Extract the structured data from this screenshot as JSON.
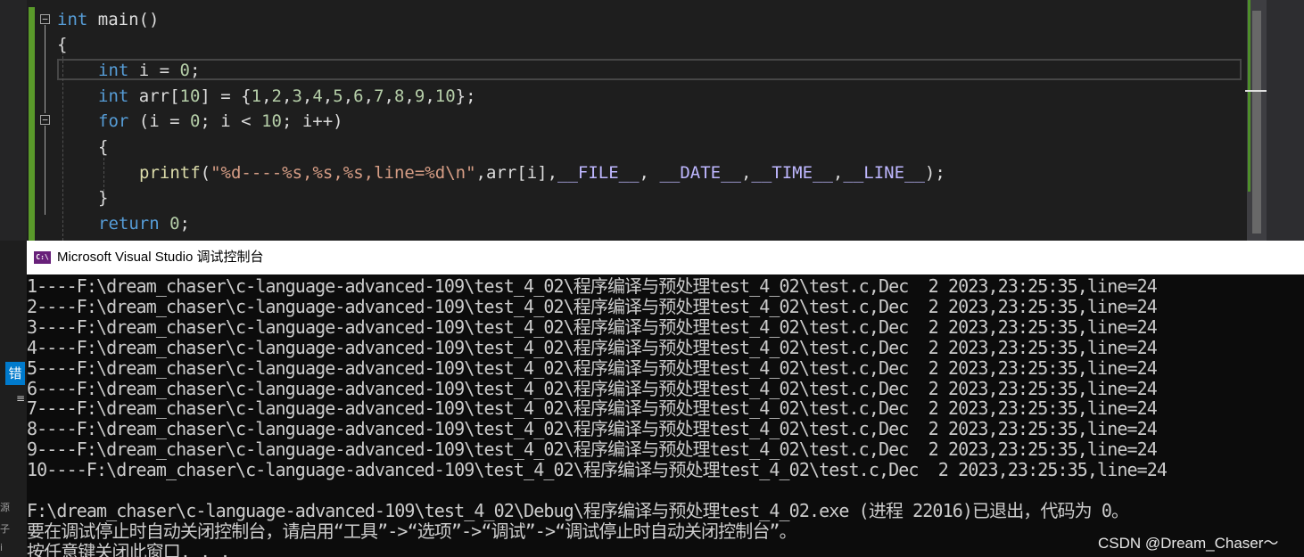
{
  "editor": {
    "lines": [
      {
        "indent": 0,
        "tokens": [
          [
            "kw",
            "int"
          ],
          [
            "txt",
            " main()"
          ]
        ]
      },
      {
        "indent": 0,
        "tokens": [
          [
            "txt",
            "{"
          ]
        ]
      },
      {
        "indent": 1,
        "tokens": [
          [
            "kw",
            "int"
          ],
          [
            "txt",
            " i = "
          ],
          [
            "num",
            "0"
          ],
          [
            "txt",
            ";"
          ]
        ]
      },
      {
        "indent": 1,
        "tokens": [
          [
            "kw",
            "int"
          ],
          [
            "txt",
            " arr["
          ],
          [
            "num",
            "10"
          ],
          [
            "txt",
            "] = {"
          ],
          [
            "num",
            "1"
          ],
          [
            "txt",
            ","
          ],
          [
            "num",
            "2"
          ],
          [
            "txt",
            ","
          ],
          [
            "num",
            "3"
          ],
          [
            "txt",
            ","
          ],
          [
            "num",
            "4"
          ],
          [
            "txt",
            ","
          ],
          [
            "num",
            "5"
          ],
          [
            "txt",
            ","
          ],
          [
            "num",
            "6"
          ],
          [
            "txt",
            ","
          ],
          [
            "num",
            "7"
          ],
          [
            "txt",
            ","
          ],
          [
            "num",
            "8"
          ],
          [
            "txt",
            ","
          ],
          [
            "num",
            "9"
          ],
          [
            "txt",
            ","
          ],
          [
            "num",
            "10"
          ],
          [
            "txt",
            "};"
          ]
        ]
      },
      {
        "indent": 1,
        "tokens": [
          [
            "kw",
            "for"
          ],
          [
            "txt",
            " (i = "
          ],
          [
            "num",
            "0"
          ],
          [
            "txt",
            "; i < "
          ],
          [
            "num",
            "10"
          ],
          [
            "txt",
            "; i++)"
          ]
        ]
      },
      {
        "indent": 1,
        "tokens": [
          [
            "txt",
            "{"
          ]
        ]
      },
      {
        "indent": 2,
        "tokens": [
          [
            "fn",
            "printf"
          ],
          [
            "txt",
            "("
          ],
          [
            "str",
            "\"%d----%s,%s,%s,line=%d\\n\""
          ],
          [
            "txt",
            ",arr[i],"
          ],
          [
            "mac",
            "__FILE__"
          ],
          [
            "txt",
            ", "
          ],
          [
            "mac",
            "__DATE__"
          ],
          [
            "txt",
            ","
          ],
          [
            "mac",
            "__TIME__"
          ],
          [
            "txt",
            ","
          ],
          [
            "mac",
            "__LINE__"
          ],
          [
            "txt",
            ");"
          ]
        ]
      },
      {
        "indent": 1,
        "tokens": [
          [
            "txt",
            "}"
          ]
        ]
      },
      {
        "indent": 1,
        "tokens": [
          [
            "kw",
            "return"
          ],
          [
            "txt",
            " "
          ],
          [
            "num",
            "0"
          ],
          [
            "txt",
            ";"
          ]
        ]
      }
    ]
  },
  "console": {
    "title": "Microsoft Visual Studio 调试控制台",
    "icon_text": "C:\\",
    "output_lines": [
      "1----F:\\dream_chaser\\c-language-advanced-109\\test_4_02\\程序编译与预处理test_4_02\\test.c,Dec  2 2023,23:25:35,line=24",
      "2----F:\\dream_chaser\\c-language-advanced-109\\test_4_02\\程序编译与预处理test_4_02\\test.c,Dec  2 2023,23:25:35,line=24",
      "3----F:\\dream_chaser\\c-language-advanced-109\\test_4_02\\程序编译与预处理test_4_02\\test.c,Dec  2 2023,23:25:35,line=24",
      "4----F:\\dream_chaser\\c-language-advanced-109\\test_4_02\\程序编译与预处理test_4_02\\test.c,Dec  2 2023,23:25:35,line=24",
      "5----F:\\dream_chaser\\c-language-advanced-109\\test_4_02\\程序编译与预处理test_4_02\\test.c,Dec  2 2023,23:25:35,line=24",
      "6----F:\\dream_chaser\\c-language-advanced-109\\test_4_02\\程序编译与预处理test_4_02\\test.c,Dec  2 2023,23:25:35,line=24",
      "7----F:\\dream_chaser\\c-language-advanced-109\\test_4_02\\程序编译与预处理test_4_02\\test.c,Dec  2 2023,23:25:35,line=24",
      "8----F:\\dream_chaser\\c-language-advanced-109\\test_4_02\\程序编译与预处理test_4_02\\test.c,Dec  2 2023,23:25:35,line=24",
      "9----F:\\dream_chaser\\c-language-advanced-109\\test_4_02\\程序编译与预处理test_4_02\\test.c,Dec  2 2023,23:25:35,line=24",
      "10----F:\\dream_chaser\\c-language-advanced-109\\test_4_02\\程序编译与预处理test_4_02\\test.c,Dec  2 2023,23:25:35,line=24",
      "",
      "F:\\dream_chaser\\c-language-advanced-109\\test_4_02\\Debug\\程序编译与预处理test_4_02.exe (进程 22016)已退出，代码为 0。",
      "要在调试停止时自动关闭控制台，请启用“工具”->“选项”->“调试”->“调试停止时自动关闭控制台”。",
      "按任意键关闭此窗口. . ."
    ]
  },
  "left_panel": {
    "tab_label": "错",
    "symbol": "≡",
    "glyphs": [
      "源",
      "子",
      "i"
    ]
  },
  "watermark": "CSDN @Dream_Chaser～",
  "colors": {
    "keyword": "#569cd6",
    "number": "#b5cea8",
    "string": "#d69d85",
    "function": "#dcdcaa",
    "macro": "#beb7ff",
    "text": "#dcdcdc",
    "console_bg": "#0c0c0c",
    "console_text": "#cccccc"
  }
}
